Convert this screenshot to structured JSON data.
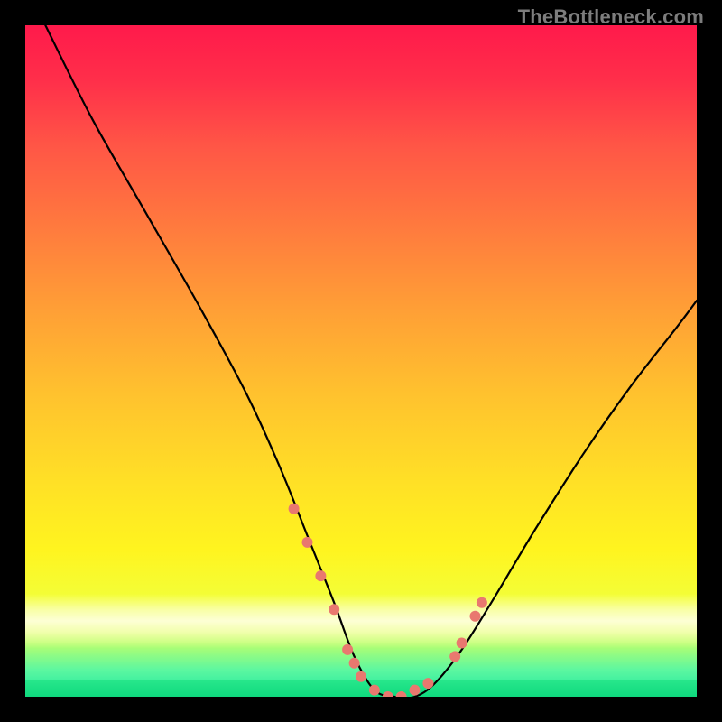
{
  "watermark": "TheBottleneck.com",
  "chart_data": {
    "type": "line",
    "title": "",
    "xlabel": "",
    "ylabel": "",
    "xlim": [
      0,
      100
    ],
    "ylim": [
      0,
      100
    ],
    "series": [
      {
        "name": "bottleneck-curve",
        "x": [
          3,
          10,
          18,
          26,
          33,
          38,
          42,
          46,
          49,
          52,
          55,
          58,
          61,
          65,
          70,
          76,
          83,
          90,
          97,
          100
        ],
        "y": [
          100,
          86,
          72,
          58,
          45,
          34,
          24,
          14,
          6,
          1,
          0,
          0,
          2,
          7,
          15,
          25,
          36,
          46,
          55,
          59
        ]
      }
    ],
    "markers": {
      "name": "highlight-dots",
      "color": "#e9786f",
      "x": [
        40,
        42,
        44,
        46,
        48,
        49,
        50,
        52,
        54,
        56,
        58,
        60,
        64,
        65,
        67,
        68
      ],
      "y": [
        28,
        23,
        18,
        13,
        7,
        5,
        3,
        1,
        0,
        0,
        1,
        2,
        6,
        8,
        12,
        14
      ]
    },
    "background_gradient": {
      "top": "#ff1a4b",
      "mid": "#ffe026",
      "bottom": "#1de79e"
    }
  }
}
